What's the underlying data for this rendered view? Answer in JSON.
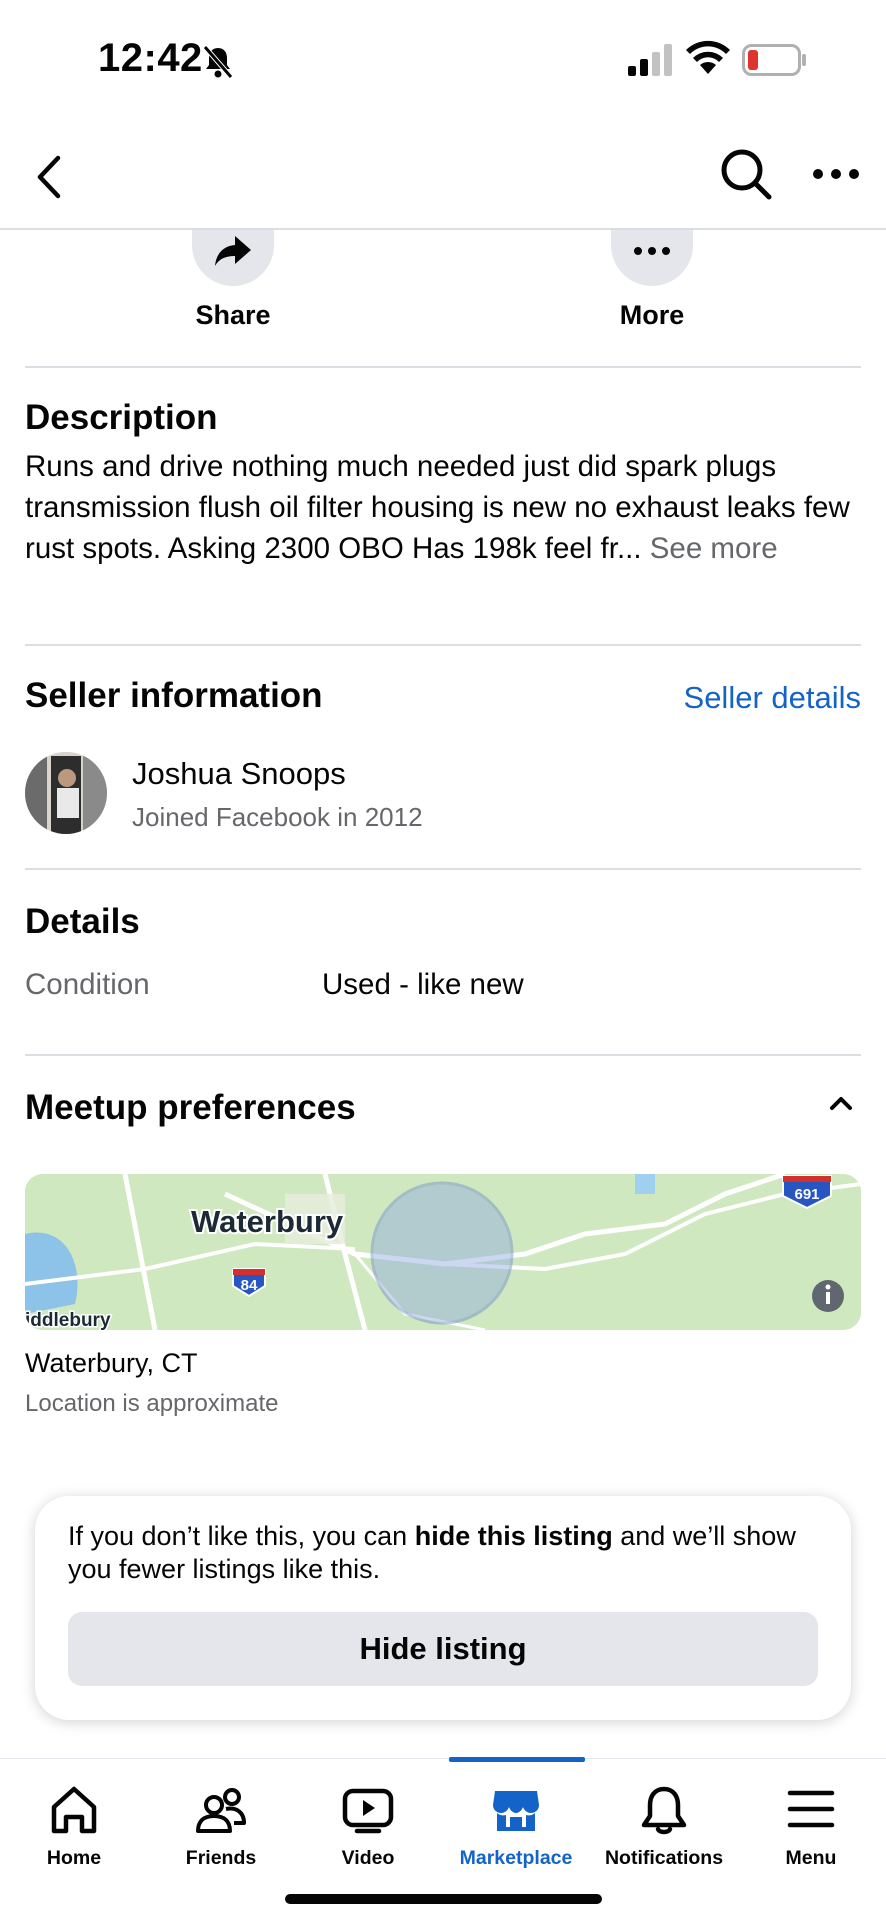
{
  "status_bar": {
    "time": "12:42"
  },
  "actions": [
    {
      "label": "Share"
    },
    {
      "label": "More"
    }
  ],
  "description": {
    "title": "Description",
    "text": "Runs and drive nothing much needed just did spark plugs transmission flush oil filter housing is new no exhaust leaks few rust spots. Asking 2300 OBO Has 198k feel fr...",
    "see_more": "See more"
  },
  "seller": {
    "title": "Seller information",
    "details_link": "Seller details",
    "name": "Joshua Snoops",
    "joined": "Joined Facebook in 2012"
  },
  "details": {
    "title": "Details",
    "condition_label": "Condition",
    "condition_value": "Used - like new"
  },
  "meetup": {
    "title": "Meetup preferences",
    "map": {
      "city_label": "Waterbury",
      "town_label": "iddlebury",
      "highway_84": "84",
      "highway_691": "691"
    },
    "location": "Waterbury, CT",
    "note": "Location is approximate"
  },
  "hide_card": {
    "text_before": "If you don’t like this, you can ",
    "text_bold": "hide this listing",
    "text_after": " and we’ll show you fewer listings like this.",
    "button": "Hide listing"
  },
  "tabs": [
    {
      "label": "Home",
      "icon": "home-icon"
    },
    {
      "label": "Friends",
      "icon": "friends-icon"
    },
    {
      "label": "Video",
      "icon": "video-icon"
    },
    {
      "label": "Marketplace",
      "icon": "marketplace-icon",
      "active": true
    },
    {
      "label": "Notifications",
      "icon": "bell-icon"
    },
    {
      "label": "Menu",
      "icon": "menu-icon"
    }
  ],
  "colors": {
    "accent": "#1463c8",
    "divider": "#dadde1",
    "secondary_text": "#65676b",
    "button_bg": "#e4e6eb"
  }
}
